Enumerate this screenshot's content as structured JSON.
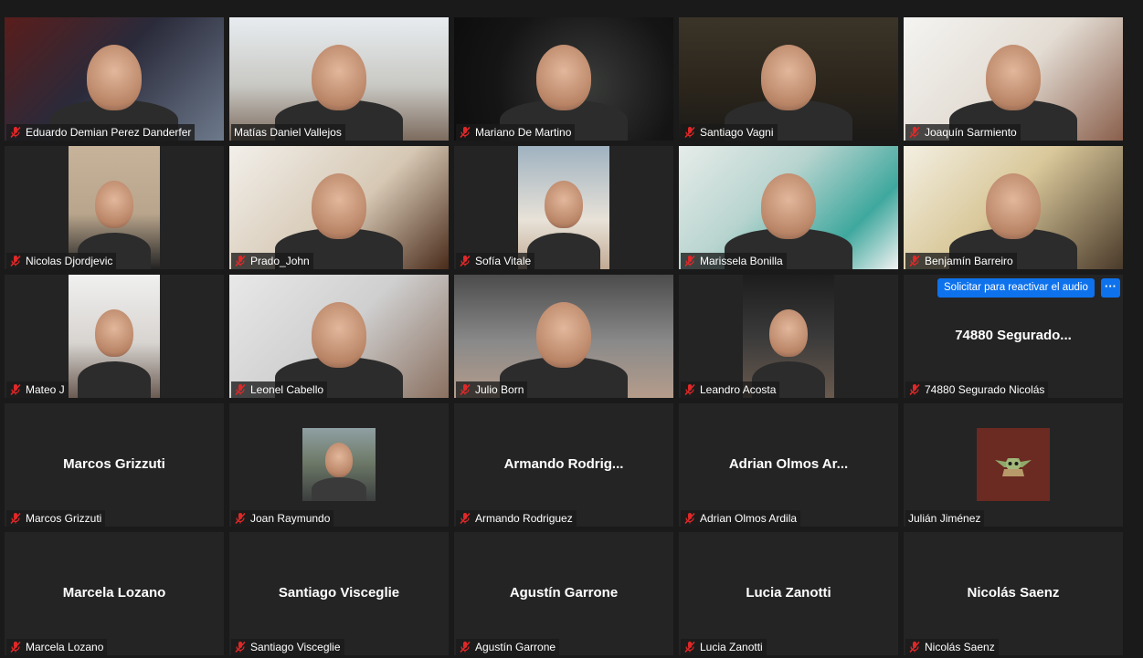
{
  "participants": [
    {
      "label": "Eduardo Demian Perez Danderfer",
      "muted": true,
      "display": "",
      "video": "v1"
    },
    {
      "label": "Matías Daniel Vallejos",
      "muted": false,
      "display": "",
      "video": "v2"
    },
    {
      "label": "Mariano De Martino",
      "muted": true,
      "display": "",
      "video": "v3"
    },
    {
      "label": "Santiago Vagni",
      "muted": true,
      "display": "",
      "video": "v4"
    },
    {
      "label": "Joaquín Sarmiento",
      "muted": true,
      "display": "",
      "video": "v5"
    },
    {
      "label": "Nicolas Djordjevic",
      "muted": true,
      "display": "",
      "video": "v6",
      "narrow": true
    },
    {
      "label": "Prado_John",
      "muted": true,
      "display": "",
      "video": "v7"
    },
    {
      "label": "Sofía Vitale",
      "muted": true,
      "display": "",
      "video": "v8",
      "narrow": true
    },
    {
      "label": "Marissela Bonilla",
      "muted": true,
      "display": "",
      "video": "v9"
    },
    {
      "label": "Benjamín Barreiro",
      "muted": true,
      "display": "",
      "video": "v10"
    },
    {
      "label": "Mateo J",
      "muted": true,
      "display": "",
      "video": "v11",
      "narrow": true
    },
    {
      "label": "Leonel Cabello",
      "muted": true,
      "display": "",
      "video": "v12"
    },
    {
      "label": "Julio Born",
      "muted": true,
      "display": "",
      "video": "v13"
    },
    {
      "label": "Leandro Acosta",
      "muted": true,
      "display": "",
      "video": "v14",
      "narrow": true
    },
    {
      "label": "74880 Segurado Nicolás",
      "muted": true,
      "display": "74880  Segurado...",
      "video": ""
    },
    {
      "label": "Marcos Grizzuti",
      "muted": true,
      "display": "Marcos Grizzuti",
      "video": ""
    },
    {
      "label": "Joan Raymundo",
      "muted": true,
      "display": "",
      "video": "",
      "avatar": "joan"
    },
    {
      "label": "Armando Rodriguez",
      "muted": true,
      "display": "Armando  Rodrig...",
      "video": ""
    },
    {
      "label": "Adrian Olmos Ardila",
      "muted": true,
      "display": "Adrian  Olmos  Ar...",
      "video": ""
    },
    {
      "label": "Julián Jiménez",
      "muted": false,
      "display": "",
      "video": "",
      "avatar": "julian"
    },
    {
      "label": "Marcela Lozano",
      "muted": true,
      "display": "Marcela Lozano",
      "video": ""
    },
    {
      "label": "Santiago Visceglie",
      "muted": true,
      "display": "Santiago Visceglie",
      "video": ""
    },
    {
      "label": "Agustín Garrone",
      "muted": true,
      "display": "Agustín Garrone",
      "video": ""
    },
    {
      "label": "Lucia Zanotti",
      "muted": true,
      "display": "Lucia Zanotti",
      "video": ""
    },
    {
      "label": "Nicolás Saenz",
      "muted": true,
      "display": "Nicolás Saenz",
      "video": ""
    }
  ],
  "reactivate_audio": {
    "button_label": "Solicitar para reactivar el audio",
    "more_label": "···"
  },
  "colors": {
    "background": "#1a1a1a",
    "tile": "#242424",
    "muted_icon": "#e02828",
    "accent_button": "#0e72ed"
  },
  "icons": {
    "mute": "microphone-muted-icon"
  }
}
